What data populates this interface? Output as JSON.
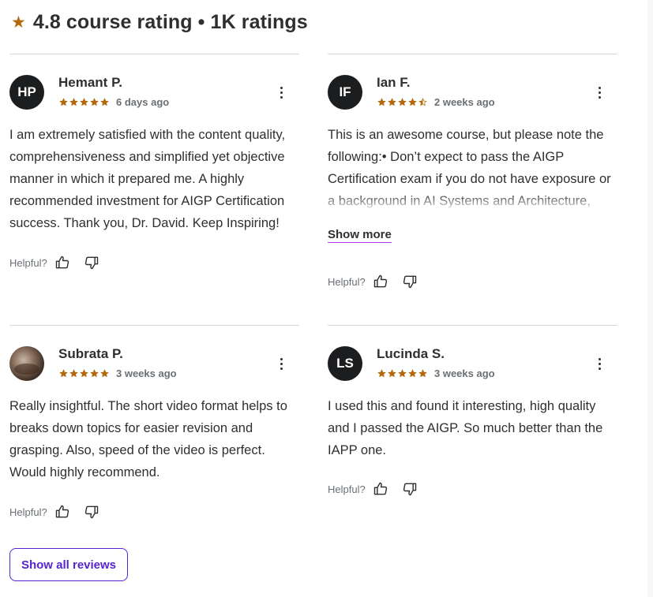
{
  "header": {
    "title": "4.8 course rating • 1K ratings",
    "star_icon": "star-icon",
    "star_color": "#b4690e"
  },
  "reviews": [
    {
      "initials": "HP",
      "name": "Hemant P.",
      "rating": 5,
      "date": "6 days ago",
      "text": "I am extremely satisfied with the content quality, comprehensiveness and simplified yet objective manner in which it prepared me. A highly recommended investment for AIGP Certification success. Thank you, Dr. David. Keep Inspiring!",
      "helpful_label": "Helpful?"
    },
    {
      "initials": "IF",
      "name": "Ian F.",
      "rating": 4.5,
      "date": "2 weeks ago",
      "text": "This is an awesome course, but please note the following:• Don’t expect to pass the AIGP Certification exam if you do not have exposure or a background in AI Systems and Architecture, Data Protection/Privacy, GRC, Legal and",
      "show_more": "Show more",
      "helpful_label": "Helpful?"
    },
    {
      "initials": "",
      "avatar_type": "photo",
      "name": "Subrata P.",
      "rating": 5,
      "date": "3 weeks ago",
      "text": "Really insightful. The short video format helps to breaks down topics for easier revision and grasping. Also, speed of the video is perfect. Would highly recommend.",
      "helpful_label": "Helpful?"
    },
    {
      "initials": "LS",
      "name": "Lucinda S.",
      "rating": 5,
      "date": "3 weeks ago",
      "text": "I used this and found it interesting, high quality and I passed the AIGP. So much better than the IAPP one.",
      "helpful_label": "Helpful?"
    }
  ],
  "footer": {
    "show_all_label": "Show all reviews"
  },
  "colors": {
    "star": "#b4690e",
    "accent": "#5624d0",
    "text": "#2d2f31",
    "muted": "#6a6f73"
  }
}
